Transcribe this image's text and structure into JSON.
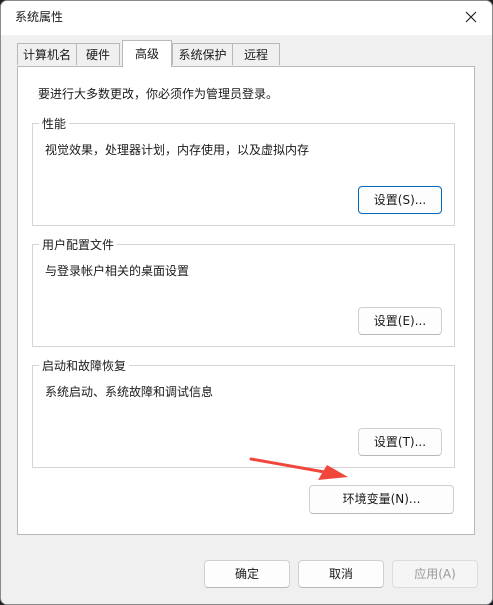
{
  "window": {
    "title": "系统属性"
  },
  "tabs": [
    {
      "label": "计算机名",
      "active": false
    },
    {
      "label": "硬件",
      "active": false
    },
    {
      "label": "高级",
      "active": true
    },
    {
      "label": "系统保护",
      "active": false
    },
    {
      "label": "远程",
      "active": false
    }
  ],
  "advanced": {
    "intro": "要进行大多数更改，你必须作为管理员登录。",
    "performance": {
      "title": "性能",
      "description": "视觉效果，处理器计划，内存使用，以及虚拟内存",
      "button": "设置(S)..."
    },
    "profiles": {
      "title": "用户配置文件",
      "description": "与登录帐户相关的桌面设置",
      "button": "设置(E)..."
    },
    "startup": {
      "title": "启动和故障恢复",
      "description": "系统启动、系统故障和调试信息",
      "button": "设置(T)..."
    },
    "env_button": "环境变量(N)..."
  },
  "footer": {
    "ok": "确定",
    "cancel": "取消",
    "apply": "应用(A)"
  },
  "colors": {
    "annotation_arrow": "#f0463c",
    "focus_border": "#0067c0"
  },
  "icons": {
    "close": "close-icon"
  }
}
